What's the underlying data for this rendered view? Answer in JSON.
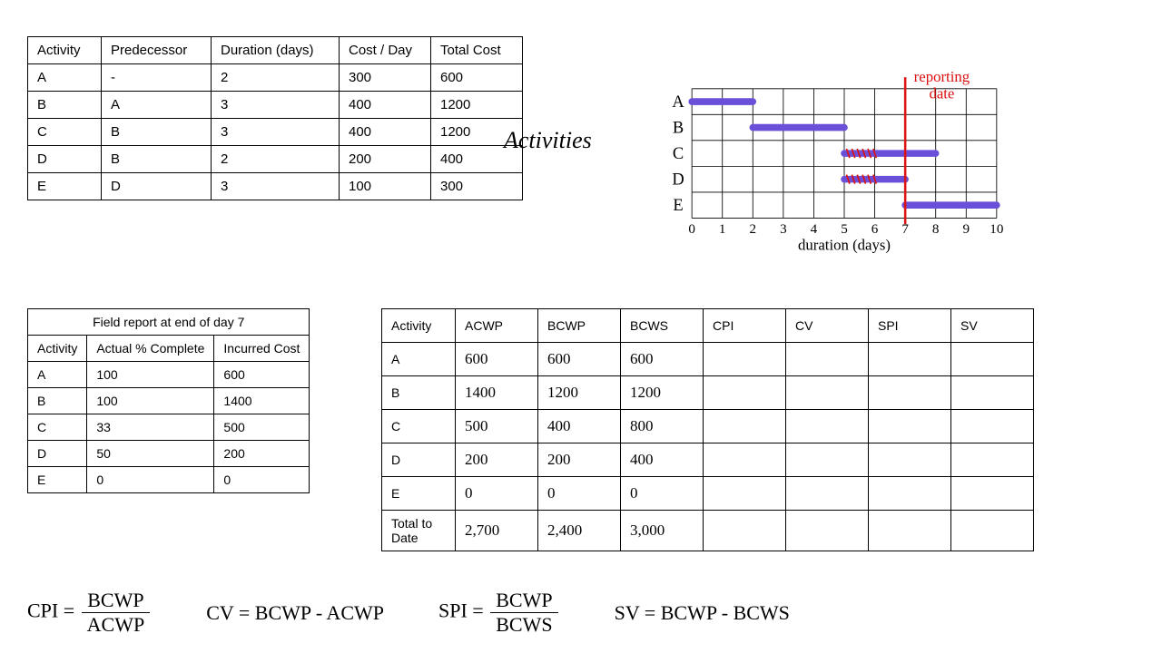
{
  "table1": {
    "headers": [
      "Activity",
      "Predecessor",
      "Duration (days)",
      "Cost / Day",
      "Total Cost"
    ],
    "rows": [
      [
        "A",
        "-",
        "2",
        "300",
        "600"
      ],
      [
        "B",
        "A",
        "3",
        "400",
        "1200"
      ],
      [
        "C",
        "B",
        "3",
        "400",
        "1200"
      ],
      [
        "D",
        "B",
        "2",
        "200",
        "400"
      ],
      [
        "E",
        "D",
        "3",
        "100",
        "300"
      ]
    ]
  },
  "activities_label": "Activities",
  "table2": {
    "title": "Field report at end of day 7",
    "headers": [
      "Activity",
      "Actual % Complete",
      "Incurred Cost"
    ],
    "rows": [
      [
        "A",
        "100",
        "600"
      ],
      [
        "B",
        "100",
        "1400"
      ],
      [
        "C",
        "33",
        "500"
      ],
      [
        "D",
        "50",
        "200"
      ],
      [
        "E",
        "0",
        "0"
      ]
    ]
  },
  "table3": {
    "headers": [
      "Activity",
      "ACWP",
      "BCWP",
      "BCWS",
      "CPI",
      "CV",
      "SPI",
      "SV"
    ],
    "rows": [
      [
        "A",
        "600",
        "600",
        "600",
        "",
        "",
        "",
        ""
      ],
      [
        "B",
        "1400",
        "1200",
        "1200",
        "",
        "",
        "",
        ""
      ],
      [
        "C",
        "500",
        "400",
        "800",
        "",
        "",
        "",
        ""
      ],
      [
        "D",
        "200",
        "200",
        "400",
        "",
        "",
        "",
        ""
      ],
      [
        "E",
        "0",
        "0",
        "0",
        "",
        "",
        "",
        ""
      ],
      [
        "Total to Date",
        "2,700",
        "2,400",
        "3,000",
        "",
        "",
        "",
        ""
      ]
    ]
  },
  "formulas": {
    "cpi_lhs": "CPI =",
    "cpi_num": "BCWP",
    "cpi_den": "ACWP",
    "cv": "CV = BCWP - ACWP",
    "spi_lhs": "SPI =",
    "spi_num": "BCWP",
    "spi_den": "BCWS",
    "sv": "SV = BCWP - BCWS"
  },
  "chart_data": {
    "type": "gantt",
    "title": "",
    "xlabel": "duration (days)",
    "ylabel": "Activities",
    "xlim": [
      0,
      10
    ],
    "x_ticks": [
      0,
      1,
      2,
      3,
      4,
      5,
      6,
      7,
      8,
      9,
      10
    ],
    "reporting_date": 7,
    "reporting_label": "reporting date",
    "activities": [
      {
        "name": "A",
        "start": 0,
        "end": 2,
        "delayed_start": null
      },
      {
        "name": "B",
        "start": 2,
        "end": 5,
        "delayed_start": null
      },
      {
        "name": "C",
        "start": 5,
        "end": 8,
        "delayed_start": 6
      },
      {
        "name": "D",
        "start": 5,
        "end": 7,
        "delayed_start": 6
      },
      {
        "name": "E",
        "start": 7,
        "end": 10,
        "delayed_start": null
      }
    ]
  }
}
